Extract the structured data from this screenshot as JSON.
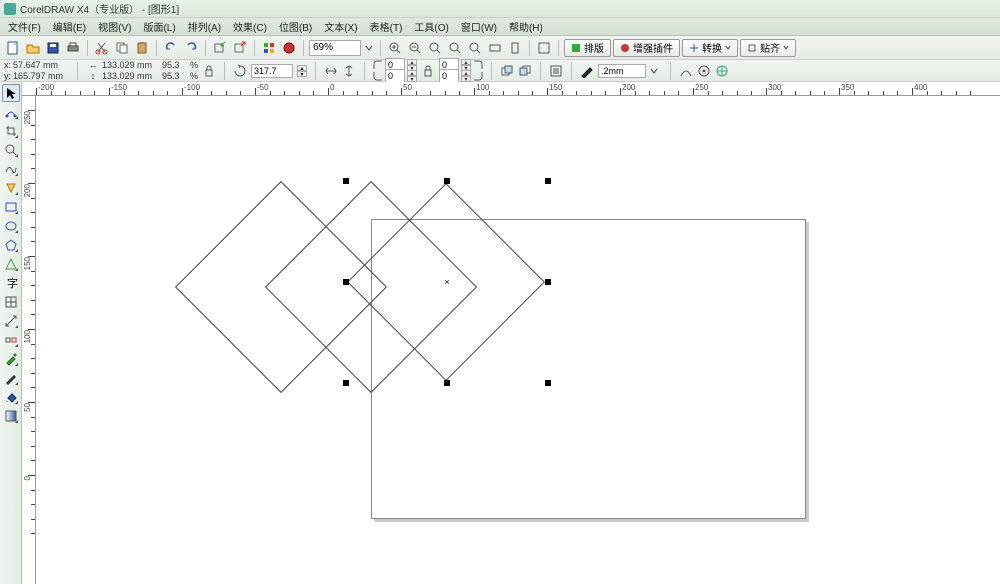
{
  "title": "CorelDRAW X4（专业版） - [图形1]",
  "menus": [
    "文件(F)",
    "编辑(E)",
    "视图(V)",
    "版面(L)",
    "排列(A)",
    "效果(C)",
    "位图(B)",
    "文本(X)",
    "表格(T)",
    "工具(O)",
    "窗口(W)",
    "帮助(H)"
  ],
  "toolbar1": {
    "zoom_value": "69%",
    "buttons_right": [
      "排版",
      "增强插件",
      "转换",
      "贴齐"
    ]
  },
  "propbar": {
    "x_label": "x:",
    "y_label": "y:",
    "x_value": "57.647 mm",
    "y_value": "165.797 mm",
    "w_value": "133.029 mm",
    "h_value": "133.029 mm",
    "sx_value": "95.3",
    "sy_value": "95.3",
    "pct": "%",
    "rotation": "317.7",
    "spin_zero": "0",
    "outline_value": ".2mm"
  },
  "ruler_h": [
    "-200",
    "-150",
    "-100",
    "-50",
    "0",
    "50",
    "100",
    "150",
    "200",
    "250",
    "300",
    "350",
    "400"
  ],
  "ruler_v": [
    "250",
    "200",
    "150",
    "100",
    "50",
    "0"
  ],
  "tools": [
    {
      "name": "pick-tool"
    },
    {
      "name": "shape-tool"
    },
    {
      "name": "crop-tool"
    },
    {
      "name": "zoom-tool"
    },
    {
      "name": "freehand-tool"
    },
    {
      "name": "smart-fill-tool"
    },
    {
      "name": "rectangle-tool"
    },
    {
      "name": "ellipse-tool"
    },
    {
      "name": "polygon-tool"
    },
    {
      "name": "basic-shapes-tool"
    },
    {
      "name": "text-tool"
    },
    {
      "name": "table-tool"
    },
    {
      "name": "dimension-tool"
    },
    {
      "name": "interactive-blend-tool"
    },
    {
      "name": "eyedropper-tool"
    },
    {
      "name": "outline-tool"
    },
    {
      "name": "fill-tool"
    },
    {
      "name": "interactive-fill-tool"
    }
  ],
  "selection": {
    "center_mark": "×"
  }
}
